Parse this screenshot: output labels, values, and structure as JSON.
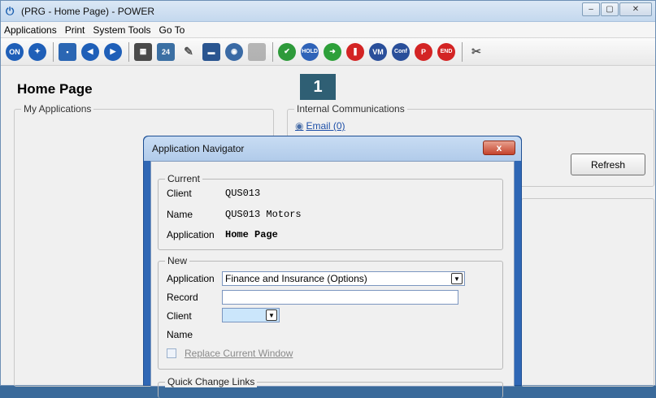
{
  "window": {
    "title": "(PRG - Home Page) - POWER",
    "controls": {
      "minimize": "–",
      "maximize": "▢",
      "close": "✕"
    }
  },
  "menu": [
    {
      "label": "Applications"
    },
    {
      "label": "Print"
    },
    {
      "label": "System Tools"
    },
    {
      "label": "Go To"
    }
  ],
  "toolbar": [
    {
      "name": "on-icon",
      "text": "ON",
      "color": "#1f5fb8"
    },
    {
      "name": "compass-icon",
      "text": "✦",
      "color": "#1f5fb8"
    },
    {
      "name": "save-icon",
      "text": "▪",
      "color": "#2b66b3"
    },
    {
      "name": "back-arrow-icon",
      "text": "◀",
      "color": "#1f5fb8"
    },
    {
      "name": "forward-arrow-icon",
      "text": "▶",
      "color": "#1f5fb8"
    },
    {
      "name": "calculator-icon",
      "text": "▦",
      "color": "#4a4a4a"
    },
    {
      "name": "calendar-icon",
      "text": "24",
      "color": "#3b6fa3"
    },
    {
      "name": "notepad-icon",
      "text": "✎",
      "color": "#555555"
    },
    {
      "name": "book-icon",
      "text": "▬",
      "color": "#2a5590"
    },
    {
      "name": "globe-mail-icon",
      "text": "◉",
      "color": "#3a6aa5"
    },
    {
      "name": "blank-icon",
      "text": "",
      "color": "#8a8a8a"
    },
    {
      "name": "checkmark-icon",
      "text": "✔",
      "color": "#2e9a3a"
    },
    {
      "name": "hold-icon",
      "text": "HOLD",
      "color": "#2f63b8"
    },
    {
      "name": "green-arrow-icon",
      "text": "➜",
      "color": "#2ea03a"
    },
    {
      "name": "stop-icon",
      "text": "❚",
      "color": "#d32424"
    },
    {
      "name": "vm-icon",
      "text": "VM",
      "color": "#2a4f9a"
    },
    {
      "name": "conf-icon",
      "text": "Conf",
      "color": "#2a4f9a"
    },
    {
      "name": "p-icon",
      "text": "P",
      "color": "#d32424"
    },
    {
      "name": "end-icon",
      "text": "END",
      "color": "#d32424"
    },
    {
      "name": "tools-icon",
      "text": "✂",
      "color": "#555555"
    }
  ],
  "page": {
    "title": "Home Page",
    "my_applications": "My Applications",
    "internal_communications": "Internal Communications",
    "email_link": "Email (0)",
    "refresh": "Refresh",
    "badge": "1"
  },
  "dialog": {
    "title": "Application Navigator",
    "close": "x",
    "current": {
      "legend": "Current",
      "client_label": "Client",
      "client_value": "QUS013",
      "name_label": "Name",
      "name_value": "QUS013 Motors",
      "application_label": "Application",
      "application_value": "Home Page"
    },
    "new": {
      "legend": "New",
      "application_label": "Application",
      "application_value": "Finance and Insurance (Options)",
      "record_label": "Record",
      "record_value": "",
      "client_label": "Client",
      "client_value": "",
      "name_label": "Name",
      "replace_label": "Replace Current Window"
    },
    "quick_change_links": "Quick Change Links"
  }
}
